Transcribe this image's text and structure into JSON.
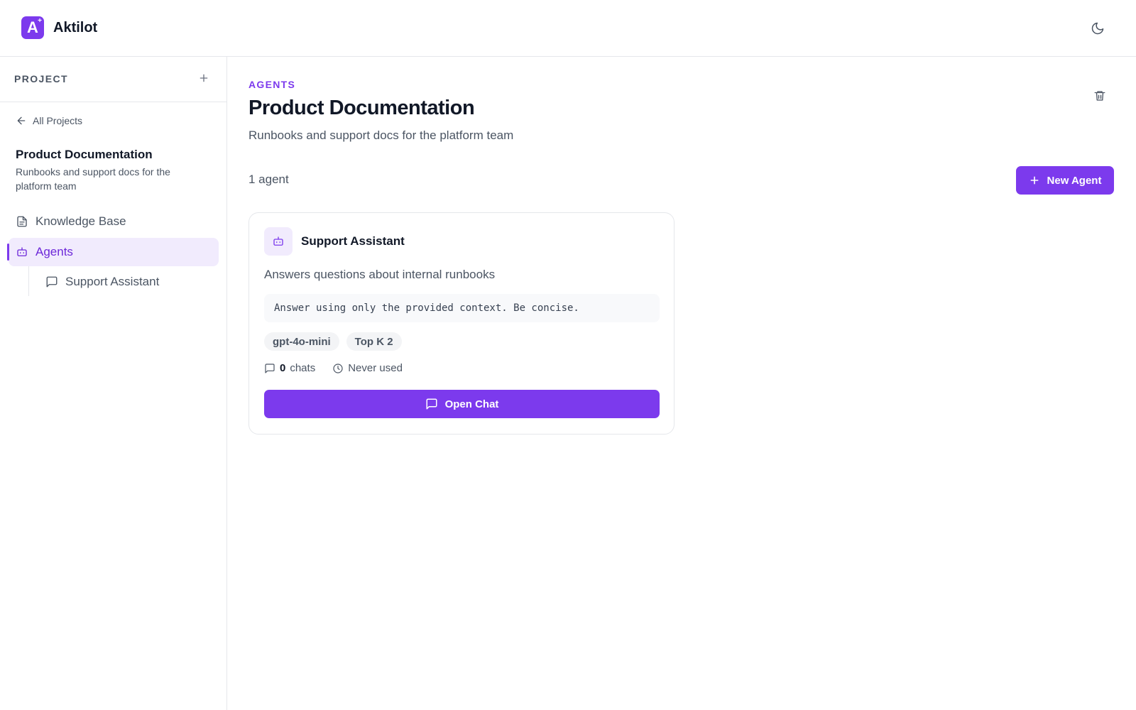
{
  "app": {
    "name": "Aktilot",
    "logo_letter": "A",
    "logo_sup": "+"
  },
  "colors": {
    "accent": "#7c3aed",
    "accent_soft": "#f1ebfd",
    "border": "#e5e7eb",
    "muted_text": "#4b5563"
  },
  "sidebar": {
    "header_label": "PROJECT",
    "back_label": "All Projects",
    "project_title": "Product Documentation",
    "project_desc": "Runbooks and support docs for the platform team",
    "items": [
      {
        "label": "Knowledge Base",
        "icon": "document-icon"
      },
      {
        "label": "Agents",
        "icon": "bot-icon",
        "active": true
      }
    ],
    "sub_items": [
      {
        "label": "Support Assistant",
        "icon": "chat-icon"
      }
    ]
  },
  "main": {
    "eyebrow": "AGENTS",
    "title": "Product Documentation",
    "subtitle": "Runbooks and support docs for the platform team",
    "count_label": "1 agent",
    "new_agent_label": "New Agent"
  },
  "agent_card": {
    "name": "Support Assistant",
    "description": "Answers questions about internal runbooks",
    "system_prompt": "Answer using only the provided context. Be concise.",
    "tags": [
      "gpt-4o-mini",
      "Top K 2"
    ],
    "chats_count": "0",
    "chats_label": "chats",
    "last_used": "Never used",
    "open_chat_label": "Open Chat"
  }
}
